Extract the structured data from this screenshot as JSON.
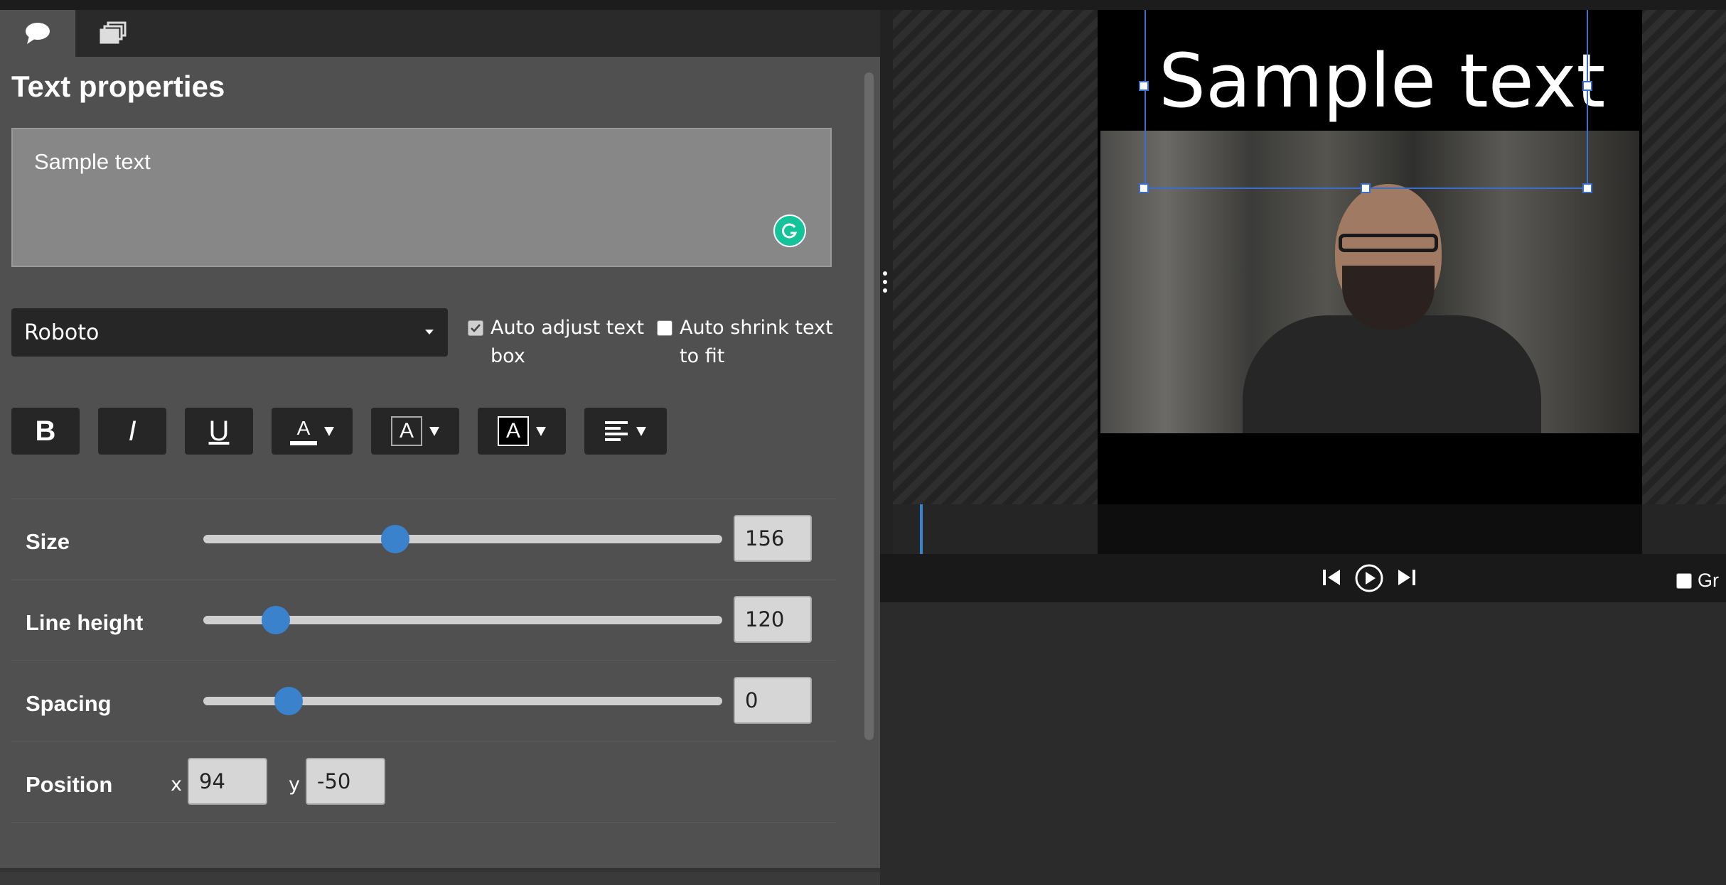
{
  "tabs": [
    {
      "icon": "speech-bubble-icon",
      "active": true
    },
    {
      "icon": "layers-icon",
      "active": false
    }
  ],
  "panel": {
    "title": "Text properties",
    "text_value": "Sample text",
    "font": "Roboto",
    "auto_adjust": {
      "line1": "Auto adjust text",
      "line2": "box",
      "checked": true
    },
    "auto_shrink": {
      "line1": "Auto shrink text",
      "line2": "to fit",
      "checked": false
    }
  },
  "format_buttons": {
    "bold": "B",
    "italic": "I",
    "underline": "U",
    "font_color": "A",
    "outline_color": "A",
    "background_color": "A"
  },
  "sliders": {
    "size": {
      "label": "Size",
      "value": "156",
      "position_fraction": 0.37
    },
    "line_height": {
      "label": "Line height",
      "value": "120",
      "position_fraction": 0.14
    },
    "spacing": {
      "label": "Spacing",
      "value": "0",
      "position_fraction": 0.165
    }
  },
  "position": {
    "label": "Position",
    "x_label": "x",
    "x_value": "94",
    "y_label": "y",
    "y_value": "-50"
  },
  "preview": {
    "overlay_text": "Sample text"
  },
  "controls": {
    "grid_label": "Gr"
  },
  "colors": {
    "accent": "#3a82cc",
    "panel": "#505050",
    "selection": "#3a6fc9",
    "grammarly": "#15c39a"
  }
}
